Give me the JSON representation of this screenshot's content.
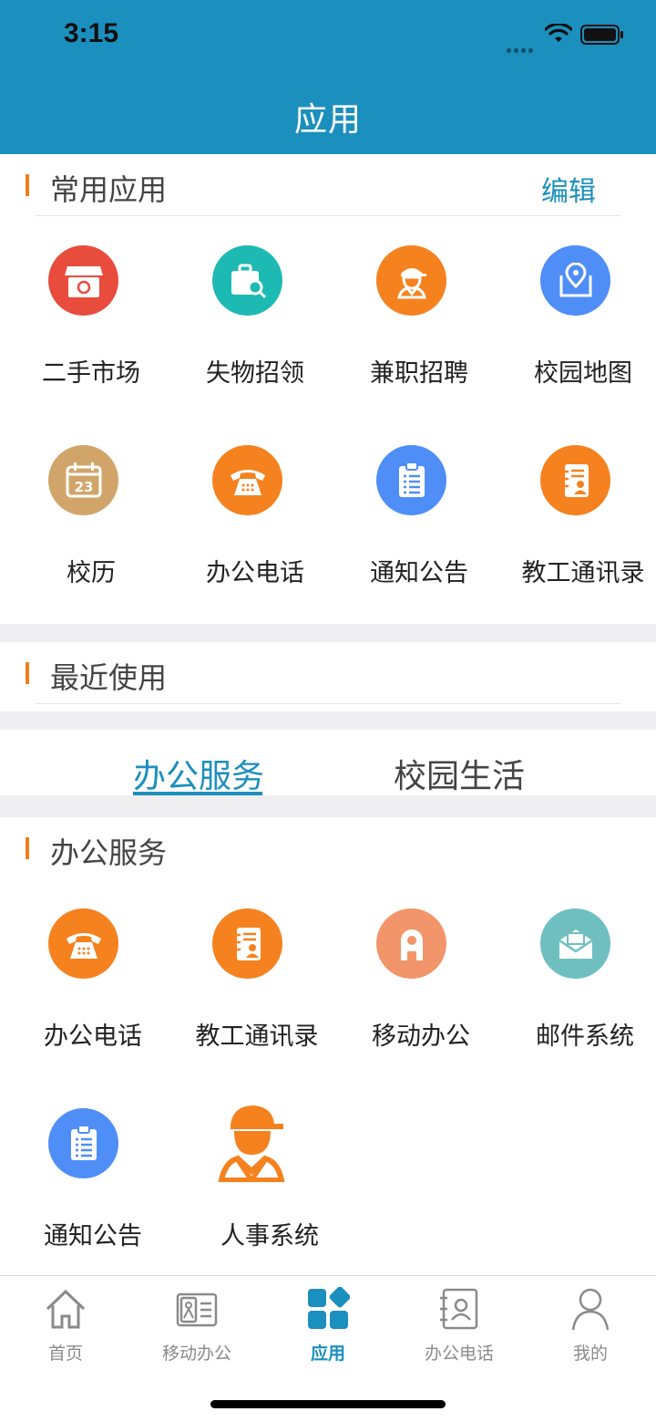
{
  "status_bar": {
    "time": "3:15"
  },
  "nav": {
    "title": "应用"
  },
  "common": {
    "title": "常用应用",
    "edit_label": "编辑",
    "apps": [
      {
        "label": "二手市场",
        "icon": "shop-icon",
        "color": "#e84c3d"
      },
      {
        "label": "失物招领",
        "icon": "lost-found-bag-icon",
        "color": "#1dbab3"
      },
      {
        "label": "兼职招聘",
        "icon": "worker-icon",
        "color": "#f5821f"
      },
      {
        "label": "校园地图",
        "icon": "map-pin-icon",
        "color": "#4f8ef7"
      },
      {
        "label": "校历",
        "icon": "calendar-icon",
        "color": "#d1a56a",
        "day": "23"
      },
      {
        "label": "办公电话",
        "icon": "telephone-icon",
        "color": "#f5821f"
      },
      {
        "label": "通知公告",
        "icon": "clipboard-icon",
        "color": "#4f8ef7"
      },
      {
        "label": "教工通讯录",
        "icon": "contacts-book-icon",
        "color": "#f5821f"
      }
    ]
  },
  "recent": {
    "title": "最近使用"
  },
  "tabs": [
    {
      "label": "办公服务",
      "active": true
    },
    {
      "label": "校园生活",
      "active": false
    }
  ],
  "office": {
    "title": "办公服务",
    "apps": [
      {
        "label": "办公电话",
        "icon": "telephone-icon",
        "color": "#f5821f"
      },
      {
        "label": "教工通讯录",
        "icon": "contacts-book-icon",
        "color": "#f5821f"
      },
      {
        "label": "移动办公",
        "icon": "mobile-office-icon",
        "color": "#f2956a"
      },
      {
        "label": "邮件系统",
        "icon": "mail-icon",
        "color": "#6fbfc1"
      },
      {
        "label": "通知公告",
        "icon": "clipboard-icon",
        "color": "#4f8ef7"
      },
      {
        "label": "人事系统",
        "icon": "personnel-worker-icon",
        "color": "#f5821f"
      }
    ]
  },
  "tabbar": [
    {
      "label": "首页",
      "icon": "home-icon",
      "active": false
    },
    {
      "label": "移动办公",
      "icon": "id-card-icon",
      "active": false
    },
    {
      "label": "应用",
      "icon": "apps-grid-icon",
      "active": true
    },
    {
      "label": "办公电话",
      "icon": "phonebook-icon",
      "active": false
    },
    {
      "label": "我的",
      "icon": "person-icon",
      "active": false
    }
  ],
  "colors": {
    "primary": "#1b8fbd",
    "accent": "#f07f1e"
  }
}
